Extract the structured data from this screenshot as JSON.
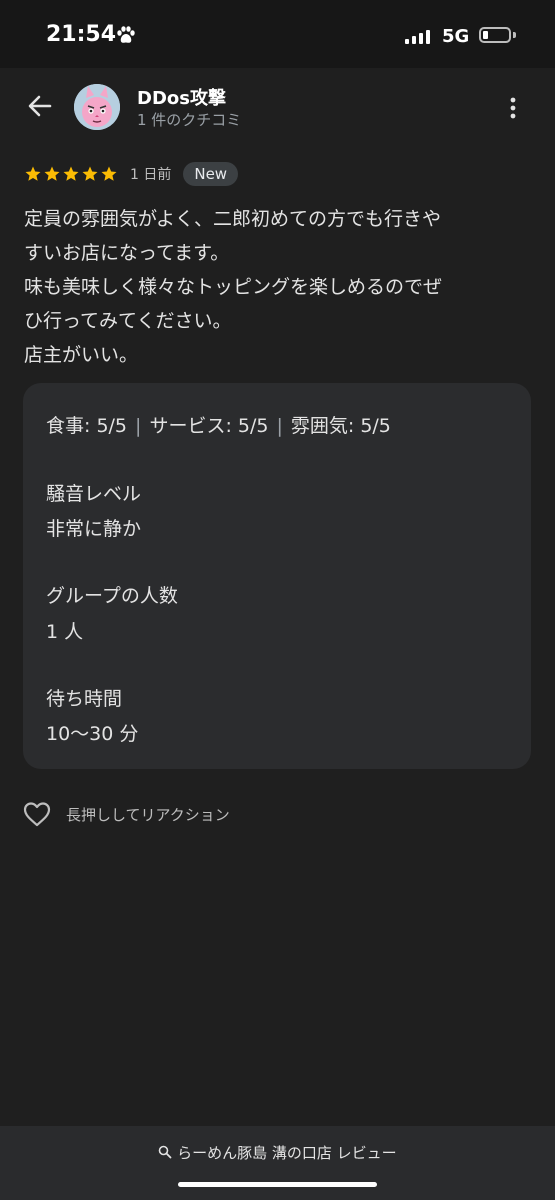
{
  "status_bar": {
    "time": "21:54",
    "network": "5G"
  },
  "review_header": {
    "author_name": "DDos攻撃",
    "author_subtitle": "1 件のクチコミ"
  },
  "rating": {
    "stars": 5,
    "date": "1 日前",
    "badge": "New"
  },
  "review_text": [
    "定員の雰囲気がよく、二郎初めての方でも行きや",
    "すいお店になってます。",
    "味も美味しく様々なトッピングを楽しめるのでぜ",
    "ひ行ってみてください。",
    "店主がいい。"
  ],
  "details": {
    "food": "食事: 5/5",
    "separator": "|",
    "service": "サービス: 5/5",
    "atmosphere": "雰囲気: 5/5",
    "noise_heading": "騒音レベル",
    "noise_value": "非常に静か",
    "group_heading": "グループの人数",
    "group_value": "1 人",
    "wait_heading": "待ち時間",
    "wait_value": "10〜30 分"
  },
  "reaction": {
    "label": "長押ししてリアクション"
  },
  "bottom_bar": {
    "search_text": "らーめん豚島 溝の口店 レビュー"
  },
  "colors": {
    "background": "#1f1f1f",
    "card": "#2b2c2e",
    "star": "#fbbc04"
  }
}
